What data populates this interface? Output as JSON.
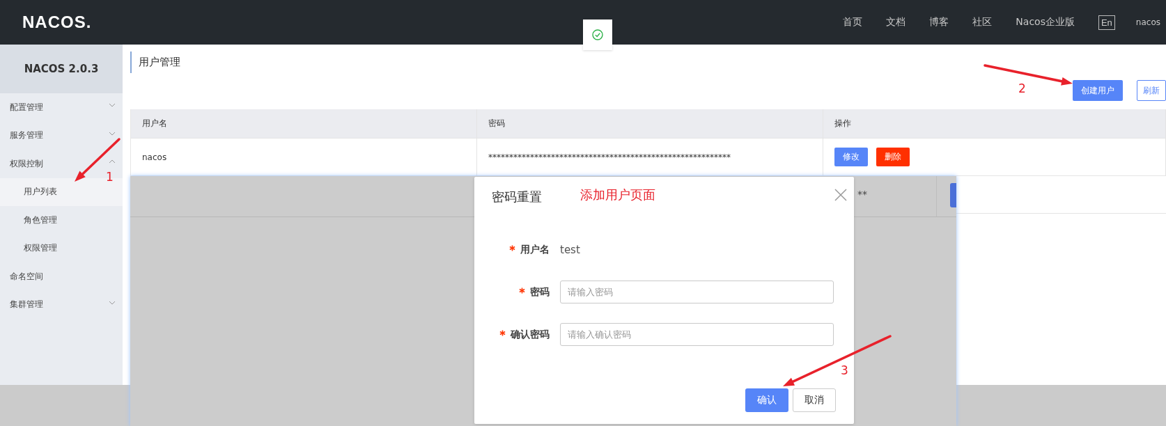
{
  "header": {
    "logo": "NACOS.",
    "nav": [
      {
        "label": "首页"
      },
      {
        "label": "文档"
      },
      {
        "label": "博客"
      },
      {
        "label": "社区"
      },
      {
        "label": "Nacos企业版"
      }
    ],
    "language": "En",
    "user": "nacos"
  },
  "sidebar": {
    "title": "NACOS 2.0.3",
    "items": [
      {
        "label": "配置管理",
        "expanded": false
      },
      {
        "label": "服务管理",
        "expanded": false
      },
      {
        "label": "权限控制",
        "expanded": true,
        "children": [
          {
            "label": "用户列表",
            "selected": true
          },
          {
            "label": "角色管理",
            "selected": false
          },
          {
            "label": "权限管理",
            "selected": false
          }
        ]
      },
      {
        "label": "命名空间"
      },
      {
        "label": "集群管理",
        "expanded": false
      }
    ]
  },
  "page": {
    "title": "用户管理",
    "buttons": [
      {
        "label": "创建用户",
        "kind": "primary"
      },
      {
        "label": "刷新",
        "kind": "outline"
      }
    ]
  },
  "table": {
    "columns": [
      "用户名",
      "密码",
      "操作"
    ],
    "rows": [
      {
        "username": "nacos",
        "password": "**********************************************************",
        "actions": [
          {
            "label": "修改",
            "kind": "edit"
          },
          {
            "label": "删除",
            "kind": "delete"
          }
        ]
      }
    ]
  },
  "backdrop": {
    "cell_text": "**"
  },
  "dialog": {
    "title": "密码重置",
    "fields": [
      {
        "label": "用户名",
        "required": true,
        "kind": "text",
        "value": "test"
      },
      {
        "label": "密码",
        "required": true,
        "kind": "input",
        "placeholder": "请输入密码"
      },
      {
        "label": "确认密码",
        "required": true,
        "kind": "input",
        "placeholder": "请输入确认密码"
      }
    ],
    "buttons": [
      {
        "label": "确认",
        "kind": "primary"
      },
      {
        "label": "取消",
        "kind": "secondary"
      }
    ]
  },
  "annotations": [
    {
      "text": "1"
    },
    {
      "text": "2"
    },
    {
      "text": "3"
    },
    {
      "text": "添加用户页面"
    }
  ]
}
